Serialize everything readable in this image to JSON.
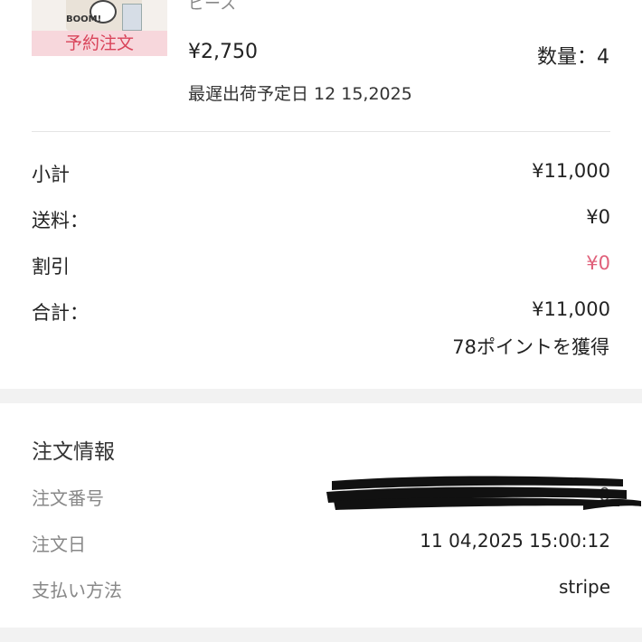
{
  "product": {
    "name": "ピース",
    "badge": "予約注文",
    "thumb_text": "BOOM!",
    "price": "¥2,750",
    "quantity": "数量：4",
    "ship_date": "最遅出荷予定日 12 15,2025"
  },
  "summary": {
    "rows": [
      {
        "label": "小計",
        "value": "¥11,000"
      },
      {
        "label": "送料：",
        "value": "¥0"
      },
      {
        "label": "割引",
        "value": "¥0"
      },
      {
        "label": "合計：",
        "value": "¥11,000"
      }
    ],
    "points": "78ポイントを獲得",
    "discount_color": "#e0607a"
  },
  "order_info": {
    "title": "注文情報",
    "rows": [
      {
        "label": "注文番号",
        "value": ""
      },
      {
        "label": "注文日",
        "value": "11 04,2025 15:00:12"
      },
      {
        "label": "支払い方法",
        "value": "stripe"
      }
    ],
    "order_number_partial": "0"
  }
}
